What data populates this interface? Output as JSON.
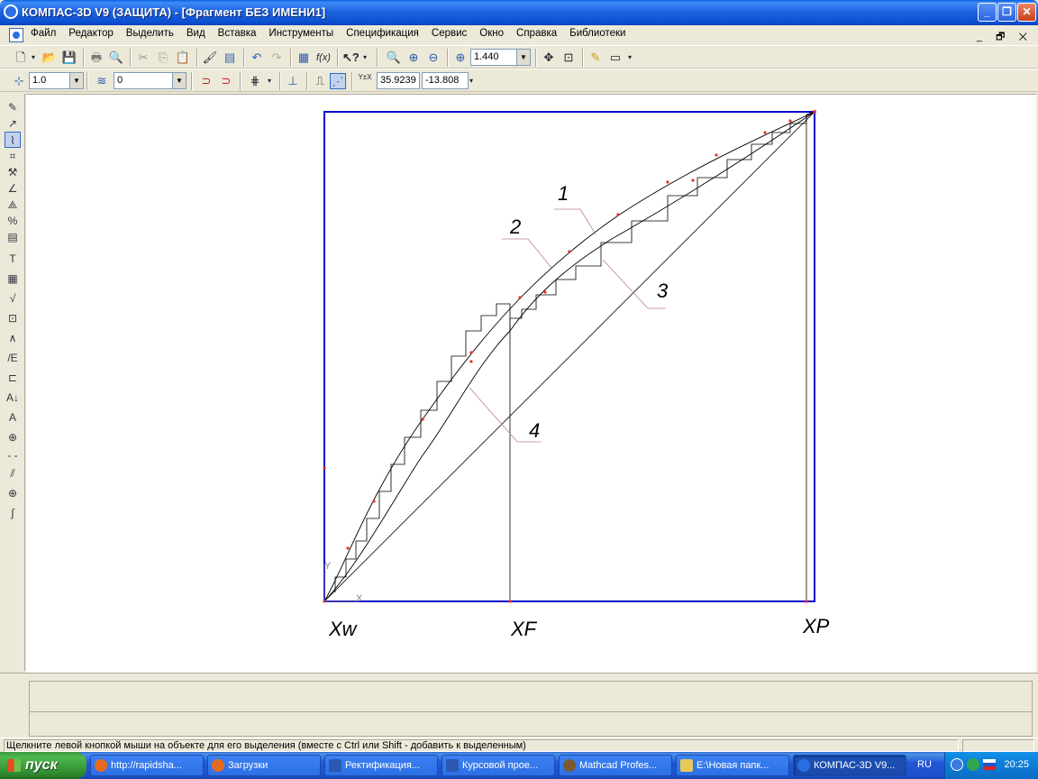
{
  "window": {
    "title": "КОМПАС-3D V9 (ЗАЩИТА) - [Фрагмент БЕЗ ИМЕНИ1]",
    "controls": [
      "_",
      "❐",
      "✕"
    ]
  },
  "menu": {
    "items": [
      "Файл",
      "Редактор",
      "Выделить",
      "Вид",
      "Вставка",
      "Инструменты",
      "Спецификация",
      "Сервис",
      "Окно",
      "Справка",
      "Библиотеки"
    ],
    "mdi_controls": "_ 🗗 ✕"
  },
  "toolbar1": {
    "zoom_value": "1.440"
  },
  "toolbar2": {
    "step_value": "1.0",
    "layer_value": "0",
    "coord_x": "35.9239",
    "coord_y": "-13.808",
    "coord_label": "Y±X"
  },
  "drawing": {
    "labels": {
      "curve1": "1",
      "curve2": "2",
      "curve3": "3",
      "curve4": "4",
      "xw": "Xw",
      "xf": "XF",
      "xp": "XP"
    },
    "axis_y": "Y",
    "axis_x": "X"
  },
  "status": {
    "message": "Щелкните левой кнопкой мыши на объекте для его выделения (вместе с Ctrl или Shift - добавить к выделенным)"
  },
  "taskbar": {
    "start": "пуск",
    "tasks": [
      {
        "label": "http://rapidsha...",
        "icon_color": "#e66a1d"
      },
      {
        "label": "Загрузки",
        "icon_color": "#e66a1d"
      },
      {
        "label": "Ректификация...",
        "icon_color": "#2a5ab0"
      },
      {
        "label": "Курсовой прое...",
        "icon_color": "#2a5ab0"
      },
      {
        "label": "Mathcad Profes...",
        "icon_color": "#7a5a30"
      },
      {
        "label": "E:\\Новая папк...",
        "icon_color": "#e8c85a"
      },
      {
        "label": "КОМПАС-3D V9...",
        "icon_color": "#2a6fe4"
      }
    ],
    "lang": "RU",
    "clock": "20:25"
  },
  "colors": {
    "titlebar": "#0A5FE0",
    "frame": "#0000CC",
    "curve": "#000000",
    "points": "#E03030"
  }
}
